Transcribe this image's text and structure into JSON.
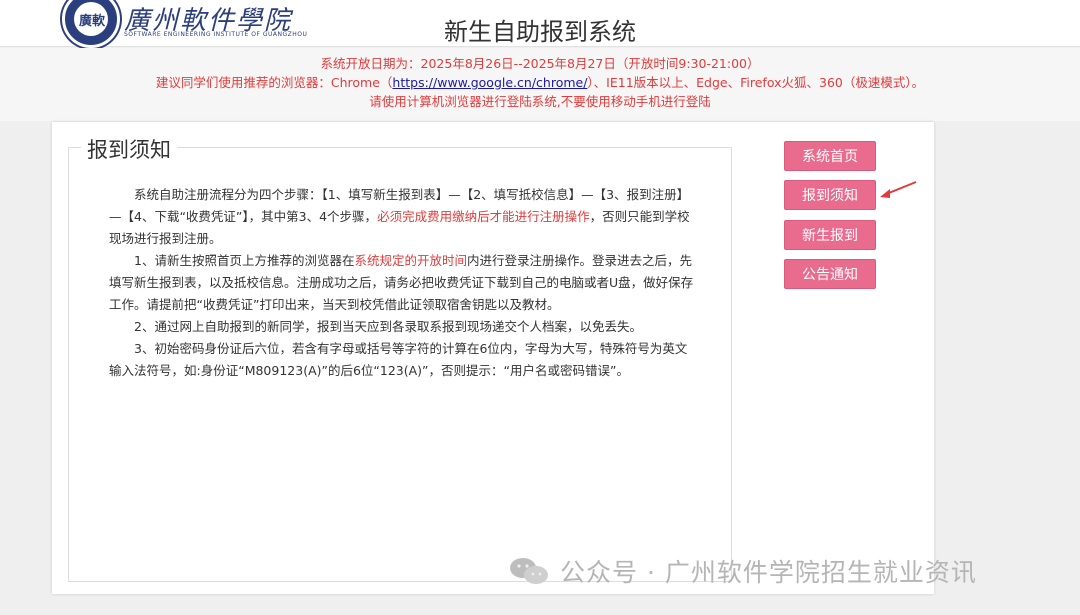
{
  "header": {
    "logo_seal_text": "廣軟",
    "logo_name": "廣州軟件學院",
    "logo_sub": "SOFTWARE ENGINEERING INSTITUTE OF GUANGZHOU",
    "title": "新生自助报到系统"
  },
  "notice": {
    "line1": "系统开放日期为：2025年8月26日--2025年8月27日（开放时间9:30-21:00）",
    "line2_prefix": "建议同学们使用推荐的浏览器：Chrome（",
    "line2_link": "https://www.google.cn/chrome/",
    "line2_suffix": "）、IE11版本以上、Edge、Firefox火狐、360（极速模式）。",
    "line3": "请使用计算机浏览器进行登陆系统,不要使用移动手机进行登陆",
    "text_color": "#e23b3b"
  },
  "main": {
    "legend": "报到须知",
    "para1_a": "系统自助注册流程分为四个步骤：【1、填写新生报到表】—【2、填写抵校信息】—【3、报到注册】—【4、下载“收费凭证”】，其中第3、4个步骤，",
    "para1_red": "必须完成费用缴纳后才能进行注册操作",
    "para1_b": "，否则只能到学校现场进行报到注册。",
    "para2_a": "1、请新生按照首页上方推荐的浏览器在",
    "para2_red": "系统规定的开放时间",
    "para2_b": "内进行登录注册操作。登录进去之后，先填写新生报到表，以及抵校信息。注册成功之后，请务必把收费凭证下载到自己的电脑或者U盘，做好保存工作。请提前把“收费凭证”打印出来，当天到校凭借此证领取宿舍钥匙以及教材。",
    "para3": "2、通过网上自助报到的新同学，报到当天应到各录取系报到现场递交个人档案，以免丢失。",
    "para4": "3、初始密码身份证后六位，若含有字母或括号等字符的计算在6位内，字母为大写，特殊符号为英文输入法符号，如:身份证“M809123(A)”的后6位“123(A)”，否则提示：“用户名或密码错误”。"
  },
  "sidebar": {
    "items": [
      {
        "label": "系统首页"
      },
      {
        "label": "报到须知"
      },
      {
        "label": "新生报到"
      },
      {
        "label": "公告通知"
      }
    ],
    "button_color": "#e96b8e"
  },
  "watermark": {
    "text": "公众号 · 广州软件学院招生就业资讯",
    "icon": "wechat-icon"
  }
}
